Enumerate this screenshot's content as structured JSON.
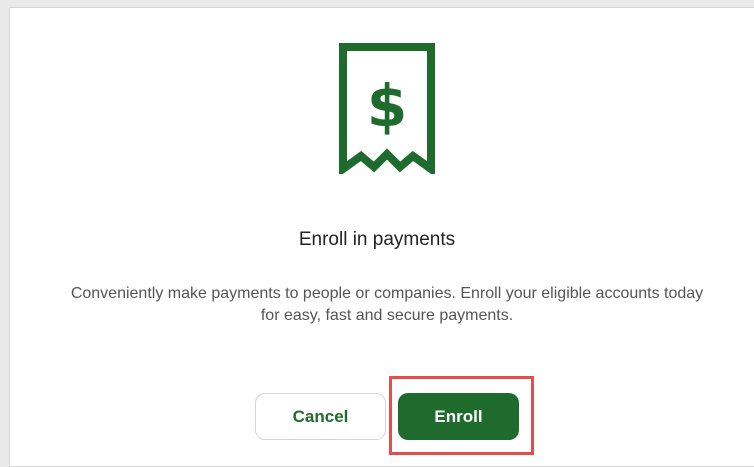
{
  "dialog": {
    "close_glyph": "×",
    "icon": "receipt-dollar-icon",
    "title": "Enroll in payments",
    "description_line1": "Conveniently make payments to people or companies. Enroll your eligible accounts today",
    "description_line2": "for easy, fast and secure payments.",
    "cancel_label": "Cancel",
    "enroll_label": "Enroll"
  },
  "colors": {
    "brand_green": "#1e6b2d",
    "highlight": "#e0504d"
  }
}
